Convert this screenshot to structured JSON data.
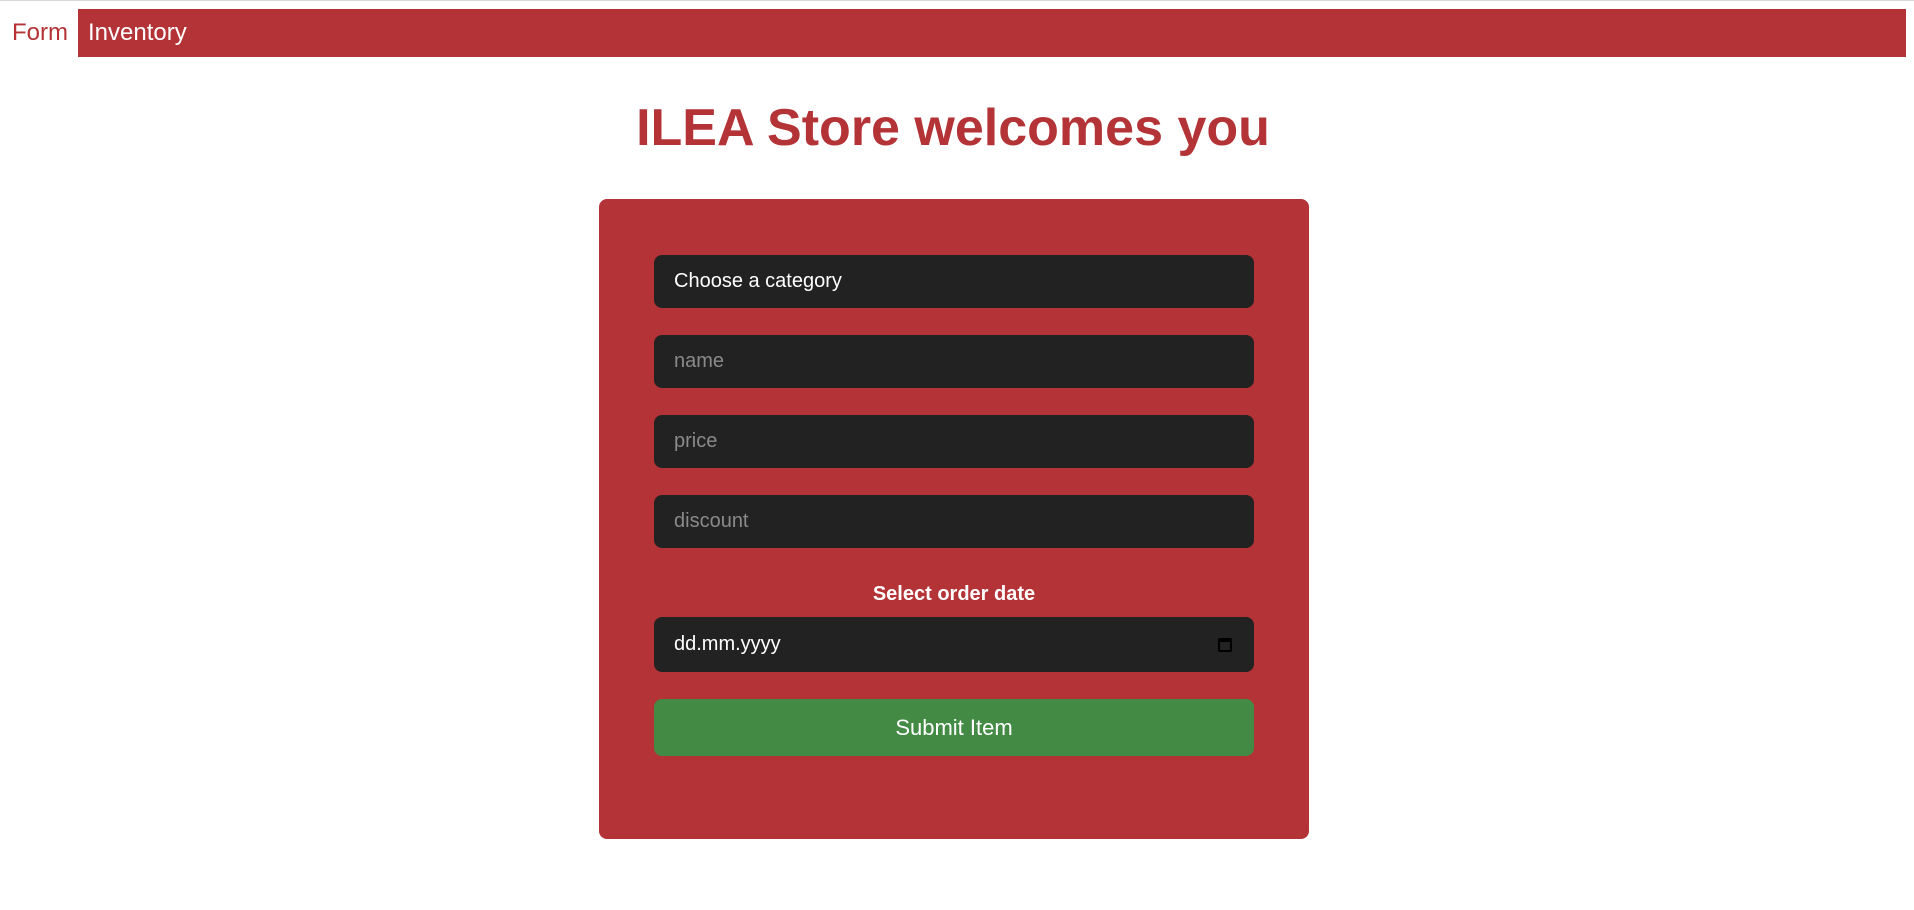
{
  "nav": {
    "items": [
      {
        "label": "Form",
        "active": true
      },
      {
        "label": "Inventory",
        "active": false
      }
    ]
  },
  "page": {
    "title": "ILEA Store welcomes you"
  },
  "form": {
    "category_select": {
      "value": "Choose a category"
    },
    "name_input": {
      "placeholder": "name"
    },
    "price_input": {
      "placeholder": "price"
    },
    "discount_input": {
      "placeholder": "discount"
    },
    "date_label": "Select order date",
    "date_input": {
      "placeholder": "dd.mm.yyyy",
      "icon": "calendar-icon"
    },
    "submit_label": "Submit Item"
  },
  "colors": {
    "brand": "#b33336",
    "field_bg": "#222222",
    "submit": "#438a45",
    "text_light": "#ffffff"
  }
}
